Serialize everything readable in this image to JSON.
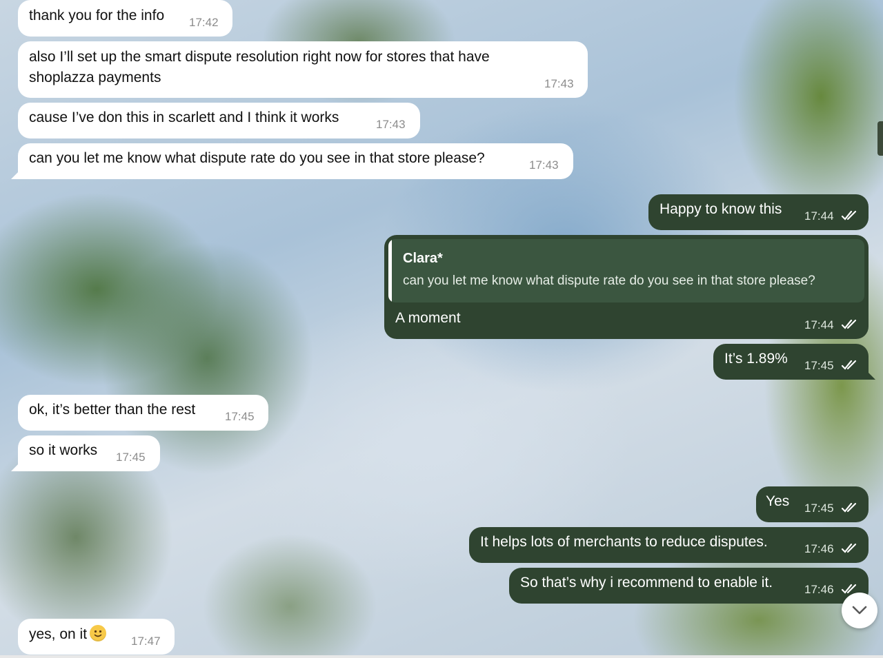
{
  "theme": {
    "incoming_bubble": "#ffffff",
    "outgoing_bubble": "#2f4430",
    "reply_block": "#3b5640",
    "emoji_color": "#f7c948"
  },
  "messages": [
    {
      "direction": "in",
      "text": "thank you for the info",
      "time": "17:42"
    },
    {
      "direction": "in",
      "text_line1": "also I’ll set up the smart dispute resolution right now for stores that have",
      "text_line2": "shoplazza payments",
      "time": "17:43"
    },
    {
      "direction": "in",
      "text": "cause I’ve don this in scarlett and I think it works",
      "time": "17:43"
    },
    {
      "direction": "in",
      "text": "can you let me know what dispute rate do you see in that store please?",
      "time": "17:43"
    },
    {
      "direction": "out",
      "text": "Happy to know this",
      "time": "17:44",
      "status": "read-double-check-icon"
    },
    {
      "direction": "out",
      "reply_to": {
        "name": "Clara*",
        "text": "can you let me know what dispute rate do you see in that store please?"
      },
      "text": "A moment",
      "time": "17:44",
      "status": "read-double-check-icon"
    },
    {
      "direction": "out",
      "text": "It’s 1.89%",
      "time": "17:45",
      "status": "read-double-check-icon"
    },
    {
      "direction": "in",
      "text": "ok, it’s better than the rest",
      "time": "17:45"
    },
    {
      "direction": "in",
      "text": "so it works",
      "time": "17:45"
    },
    {
      "direction": "out",
      "text": "Yes",
      "time": "17:45",
      "status": "read-double-check-icon"
    },
    {
      "direction": "out",
      "text": "It helps lots of merchants to reduce disputes.",
      "time": "17:46",
      "status": "read-double-check-icon"
    },
    {
      "direction": "out",
      "text": "So that’s why i recommend to enable it.",
      "time": "17:46",
      "status": "read-double-check-icon"
    },
    {
      "direction": "in",
      "text": "yes, on it",
      "emoji": "slightly-smiling-face-emoji",
      "time": "17:47"
    }
  ],
  "controls": {
    "scroll_button_icon": "chevron-down-icon"
  }
}
